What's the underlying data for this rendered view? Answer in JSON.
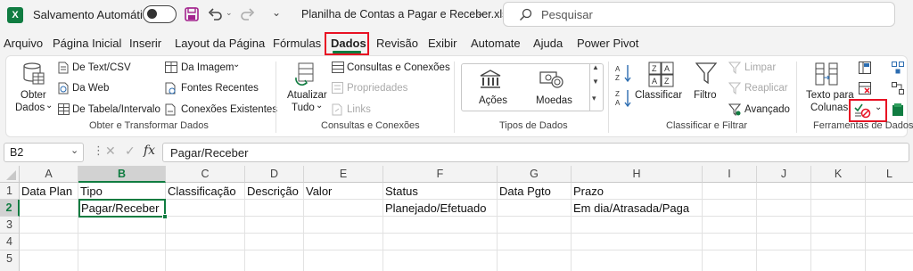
{
  "app": {
    "autosave_label": "Salvamento Automático",
    "filename": "Planilha de Contas a Pagar e Receber.xlsx",
    "search_placeholder": "Pesquisar",
    "colors": {
      "excel_green": "#107c41",
      "accent_red": "#e81123",
      "active_tab_green": "#107c41"
    }
  },
  "menu": {
    "tabs": [
      "Arquivo",
      "Página Inicial",
      "Inserir",
      "Layout da Página",
      "Fórmulas",
      "Dados",
      "Revisão",
      "Exibir",
      "Automate",
      "Ajuda",
      "Power Pivot"
    ],
    "active": "Dados"
  },
  "ribbon": {
    "get_transform": {
      "obter_dados_1": "Obter",
      "obter_dados_2": "Dados",
      "de_text_csv": "De Text/CSV",
      "da_web": "Da Web",
      "de_tabela": "De Tabela/Intervalo",
      "da_imagem": "Da Imagem",
      "fontes_recentes": "Fontes Recentes",
      "conexoes_existentes": "Conexões Existentes",
      "group_label": "Obter e Transformar Dados"
    },
    "queries": {
      "atualizar_1": "Atualizar",
      "atualizar_2": "Tudo",
      "consultas_conexoes": "Consultas e Conexões",
      "propriedades": "Propriedades",
      "links": "Links",
      "group_label": "Consultas e Conexões"
    },
    "data_types": {
      "acoes": "Ações",
      "moedas": "Moedas",
      "group_label": "Tipos de Dados"
    },
    "sort_filter": {
      "classificar": "Classificar",
      "filtro": "Filtro",
      "limpar": "Limpar",
      "reaplicar": "Reaplicar",
      "avancado": "Avançado",
      "group_label": "Classificar e Filtrar"
    },
    "data_tools": {
      "texto_colunas_1": "Texto para",
      "texto_colunas_2": "Colunas",
      "group_label": "Ferramentas de Dados"
    }
  },
  "formula_bar": {
    "name_box": "B2",
    "fx": "fx",
    "content": "Pagar/Receber"
  },
  "sheet": {
    "columns": [
      "A",
      "B",
      "C",
      "D",
      "E",
      "F",
      "G",
      "H",
      "I",
      "J",
      "K",
      "L"
    ],
    "rows": [
      "1",
      "2",
      "3",
      "4",
      "5"
    ],
    "row1": [
      "Data Plan",
      "Tipo",
      "Classificação",
      "Descrição",
      "Valor",
      "Status",
      "Data Pgto",
      "Prazo"
    ],
    "row2": {
      "B": "Pagar/Receber",
      "F": "Planejado/Efetuado",
      "H": "Em dia/Atrasada/Paga"
    }
  }
}
